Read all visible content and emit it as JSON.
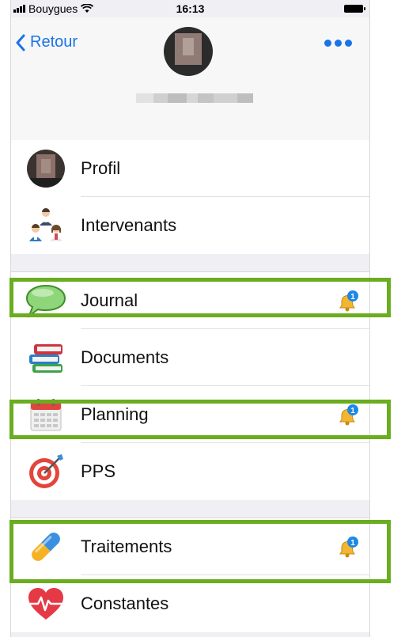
{
  "status_bar": {
    "carrier": "Bouygues",
    "time": "16:13"
  },
  "nav": {
    "back_label": "Retour",
    "more_label": "•••"
  },
  "colors": {
    "accent": "#1a73e8",
    "highlight": "#6aad1f",
    "badge": "#1e88e5",
    "bell": "#f2b632"
  },
  "menu": {
    "profil": {
      "label": "Profil",
      "icon": "profile-photo-icon"
    },
    "intervenants": {
      "label": "Intervenants",
      "icon": "people-icon"
    },
    "journal": {
      "label": "Journal",
      "icon": "speech-bubble-icon",
      "badge": "1"
    },
    "documents": {
      "label": "Documents",
      "icon": "books-icon"
    },
    "planning": {
      "label": "Planning",
      "icon": "calendar-icon",
      "badge": "1"
    },
    "pps": {
      "label": "PPS",
      "icon": "target-icon"
    },
    "traitements": {
      "label": "Traitements",
      "icon": "pill-icon",
      "badge": "1"
    },
    "constantes": {
      "label": "Constantes",
      "icon": "heart-pulse-icon"
    }
  }
}
